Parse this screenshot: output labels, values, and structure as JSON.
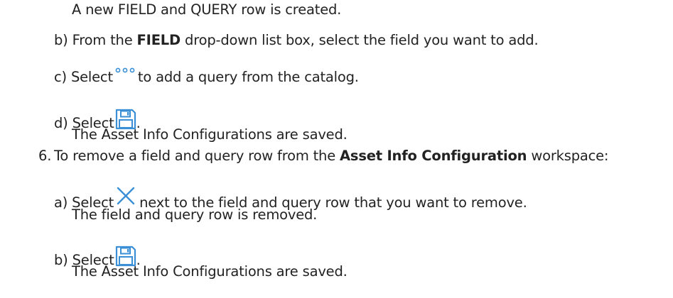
{
  "intro_result": "A new FIELD and QUERY row is created.",
  "step_b1": {
    "marker": "b)",
    "before": "From the",
    "bold": "FIELD",
    "after": "drop-down list box, select the field you want to add."
  },
  "step_c1": {
    "marker": "c)",
    "before": "Select",
    "after": "to add a query from the catalog."
  },
  "step_d1": {
    "marker": "d)",
    "before": "Select",
    "after": ".",
    "result": "The Asset Info Configurations are saved."
  },
  "step_6": {
    "marker": "6.",
    "before": "To remove a field and query row from the",
    "bold": "Asset Info Configuration",
    "after": "workspace:"
  },
  "step_a2": {
    "marker": "a)",
    "before": "Select",
    "after": "next to the field and query row that you want to remove.",
    "result": "The field and query row is removed."
  },
  "step_b2": {
    "marker": "b)",
    "before": "Select",
    "after": ".",
    "result": "The Asset Info Configurations are saved."
  },
  "icon_color": "#3b8fd6"
}
